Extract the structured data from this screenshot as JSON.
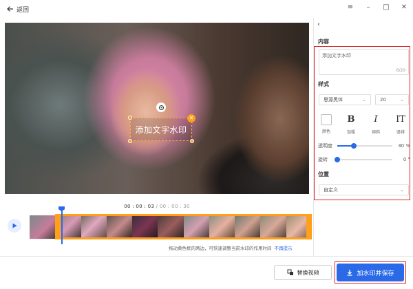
{
  "titlebar": {
    "back_label": "返回"
  },
  "watermark": {
    "text": "添加文字水印"
  },
  "panel": {
    "content_title": "内容",
    "textarea_value": "添加文字水印",
    "char_counter": "6/20",
    "style_title": "样式",
    "font_family_value": "思源黑体",
    "font_size_value": "20",
    "style_buttons": [
      {
        "glyph": "",
        "label": "颜色"
      },
      {
        "glyph": "B",
        "label": "加粗"
      },
      {
        "glyph": "I",
        "label": "倾斜"
      },
      {
        "glyph": "IT",
        "label": "竖排"
      }
    ],
    "opacity": {
      "label": "透明度",
      "value_text": "30 %",
      "fraction": 0.3
    },
    "rotation": {
      "label": "旋转",
      "value_text": "0 °",
      "fraction": 0.0
    },
    "position_title": "位置",
    "position_value": "自定义"
  },
  "playback": {
    "current_time": "00 : 00 : 03",
    "total_time": "/ 00 : 00 : 30"
  },
  "hint": {
    "text": "拖动黄色框的两边，可快速调整当前水印的作用时间",
    "dismiss": "不再提示"
  },
  "buttons": {
    "replace_video": "替换视频",
    "add_and_save": "加水印并保存"
  },
  "colors": {
    "accent": "#2a6ae8",
    "selection": "#ff9f1a",
    "highlight_box": "#e02020"
  }
}
